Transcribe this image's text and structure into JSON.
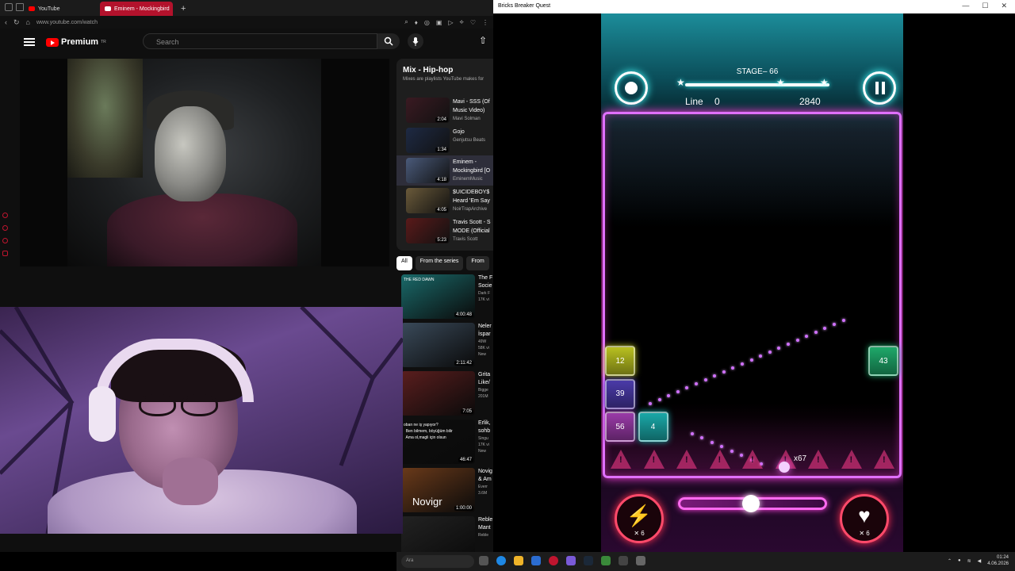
{
  "browser": {
    "tabs": [
      {
        "label": "YouTube",
        "active": false
      },
      {
        "label": "Eminem - Mockingbird",
        "active": true
      }
    ],
    "new_tab": "+",
    "url": "www.youtube.com/watch",
    "header": {
      "logo": "Premium",
      "logo_region": "TR",
      "search_placeholder": "Search"
    },
    "mix": {
      "title": "Mix - Hip-hop",
      "subtitle": "Mixes are playlists YouTube makes for",
      "items": [
        {
          "title1": "Mavi - SSS (Of",
          "title2": "Music Video)",
          "channel": "Mavi Solman",
          "duration": "2:04",
          "color": "#3a1a22"
        },
        {
          "title1": "Gojo",
          "title2": "",
          "channel": "Genjutsu Beats",
          "duration": "1:34",
          "color": "#1e2a44"
        },
        {
          "title1": "Eminem -",
          "title2": "Mockingbird [O",
          "channel": "EminemMusic",
          "duration": "4:18",
          "color": "#4a5a7a",
          "playing": true
        },
        {
          "title1": "$UICIDEBOY$",
          "title2": "Heard 'Em Say",
          "channel": "NoirTrapArchive",
          "duration": "4:05",
          "color": "#6a5a3a"
        },
        {
          "title1": "Travis Scott - S",
          "title2": "MODE (Official",
          "channel": "Travis Scott",
          "duration": "5:23",
          "color": "#5a1a1a"
        }
      ]
    },
    "chips": [
      "All",
      "From the series",
      "From"
    ],
    "recs": [
      {
        "t1": "The F",
        "t2": "Socie",
        "m1": "Dark F",
        "m2": "17K vi",
        "duration": "4:00:48",
        "color": "#1a6a6a",
        "caption": "THE RED DAWN"
      },
      {
        "t1": "Neler",
        "t2": "İspar",
        "m1": "49W",
        "m2": "58K vi",
        "duration": "2:11:42",
        "color": "#3a4a5a",
        "badge": "New"
      },
      {
        "t1": "Grita",
        "t2": "Like/",
        "m1": "Bigge",
        "m2": "201M",
        "duration": "7:05",
        "color": "#5a1e1e"
      },
      {
        "t1": "Erlik,",
        "t2": "sohb",
        "m1": "Singu",
        "m2": "17K vi",
        "duration": "46:47",
        "color": "#0e0e0e",
        "badge": "New",
        "caption": "oban ne iş yapıyor?\n  Ben bilmem, böyüğüm bilir\n  Ama ol,magli için olsun"
      },
      {
        "t1": "Novig",
        "t2": "& Am",
        "m1": "Everr",
        "m2": "3.6M",
        "duration": "1:00:00",
        "color": "#6a3a1a",
        "big": "Novigr"
      },
      {
        "t1": "Reble",
        "t2": "Mant",
        "m1": "Reble",
        "m2": "",
        "duration": "",
        "color": "#222222"
      }
    ]
  },
  "taskbar": {
    "search": "Ara",
    "time": "01:24",
    "date": "4.06.2026"
  },
  "game": {
    "window_title": "Bricks Breaker Quest",
    "window_buttons": [
      "—",
      "☐",
      "✕"
    ],
    "stage_label": "STAGE– 66",
    "line_label": "Line",
    "line_value": "0",
    "score": "2840",
    "ball_count": "x67",
    "power_left": {
      "glyph": "⚡",
      "count": "✕ 6"
    },
    "power_right": {
      "glyph": "♥",
      "count": "✕ 6"
    },
    "slider_level": 0.49,
    "bricks": [
      {
        "value": "12",
        "color": "#b8c020",
        "col": 0,
        "row": 0
      },
      {
        "value": "39",
        "color": "#4a3aa8",
        "col": 0,
        "row": 1
      },
      {
        "value": "56",
        "color": "#9a3aa8",
        "col": 0,
        "row": 2
      },
      {
        "value": "4",
        "color": "#1aa8a8",
        "col": 1,
        "row": 2
      },
      {
        "value": "43",
        "color": "#1ea86a",
        "col": 8,
        "row": 0
      }
    ],
    "colors": {
      "frame": "#e070ff",
      "accent": "#44ffff",
      "power": "#ff4a6a"
    }
  }
}
